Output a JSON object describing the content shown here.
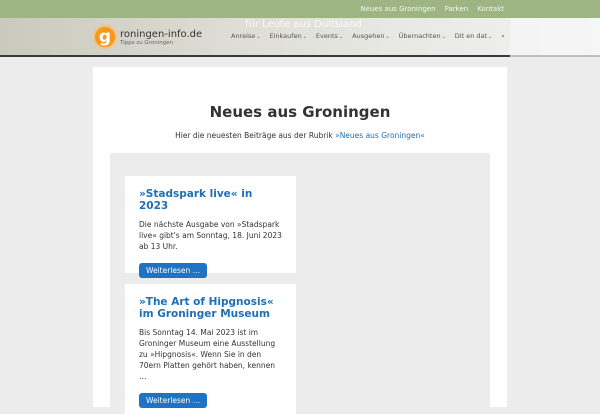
{
  "topbar": {
    "links": [
      "Neues aus Groningen",
      "Parken",
      "Kontakt"
    ]
  },
  "header": {
    "tagline": "für Leute aus Duitsland",
    "logo_letter": "g",
    "site_name": "roningen-info.de",
    "site_sub": "Tipps zu Groningen",
    "nav": [
      "Anreise",
      "Einkaufen",
      "Events",
      "Ausgehen",
      "Übernachten",
      "Dit en dat"
    ],
    "chevron": "⌄",
    "search_icon": "⌕"
  },
  "main": {
    "title": "Neues aus Groningen",
    "intro_text": "Hier die neuesten Beiträge aus der Rubrik ",
    "intro_link": "»Neues aus Groningen«",
    "posts": [
      {
        "title": "»Stadspark live« in 2023",
        "excerpt": "Die nächste Ausgabe von »Stadspark live« gibt's am Sonntag, 18. Juni 2023 ab 13 Uhr.",
        "button": "Weiterlesen …"
      },
      {
        "title": "»The Art of Hipgnosis« im Groninger Museum",
        "excerpt": "Bis Sonntag 14. Mai 2023 ist im Groninger Museum eine Ausstellung zu »Hipgnosis«. Wenn Sie in den 70ern Platten gehört haben, kennen …",
        "button": "Weiterlesen …"
      }
    ]
  }
}
